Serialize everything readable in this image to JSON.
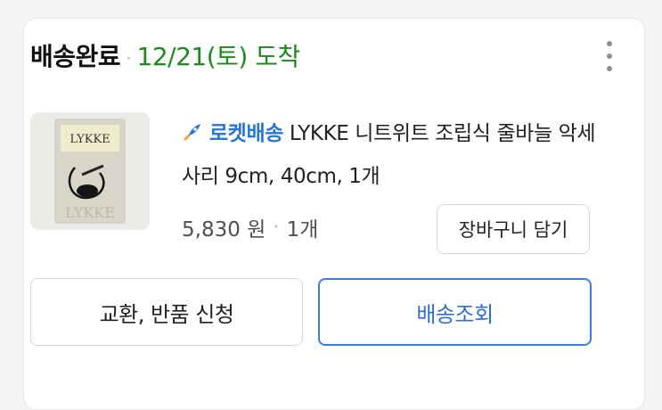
{
  "order": {
    "status": "배송완료",
    "arrival": "12/21(토) 도착"
  },
  "product": {
    "badge": "로켓배송",
    "title": "LYKKE 니트위트 조립식 줄바늘 악세사리 9cm, 40cm, 1개",
    "thumbnail_brand": "LYKKE",
    "price": "5,830 원",
    "quantity": "1개"
  },
  "buttons": {
    "add_to_cart": "장바구니 담기",
    "exchange_return": "교환, 반품 신청",
    "track_delivery": "배송조회"
  },
  "icons": {
    "more": "kebab-menu-icon",
    "rocket": "rocket-icon"
  },
  "colors": {
    "arrival": "#1c8a1c",
    "rocket": "#2a76d8",
    "track_button": "#3d7fd6"
  }
}
